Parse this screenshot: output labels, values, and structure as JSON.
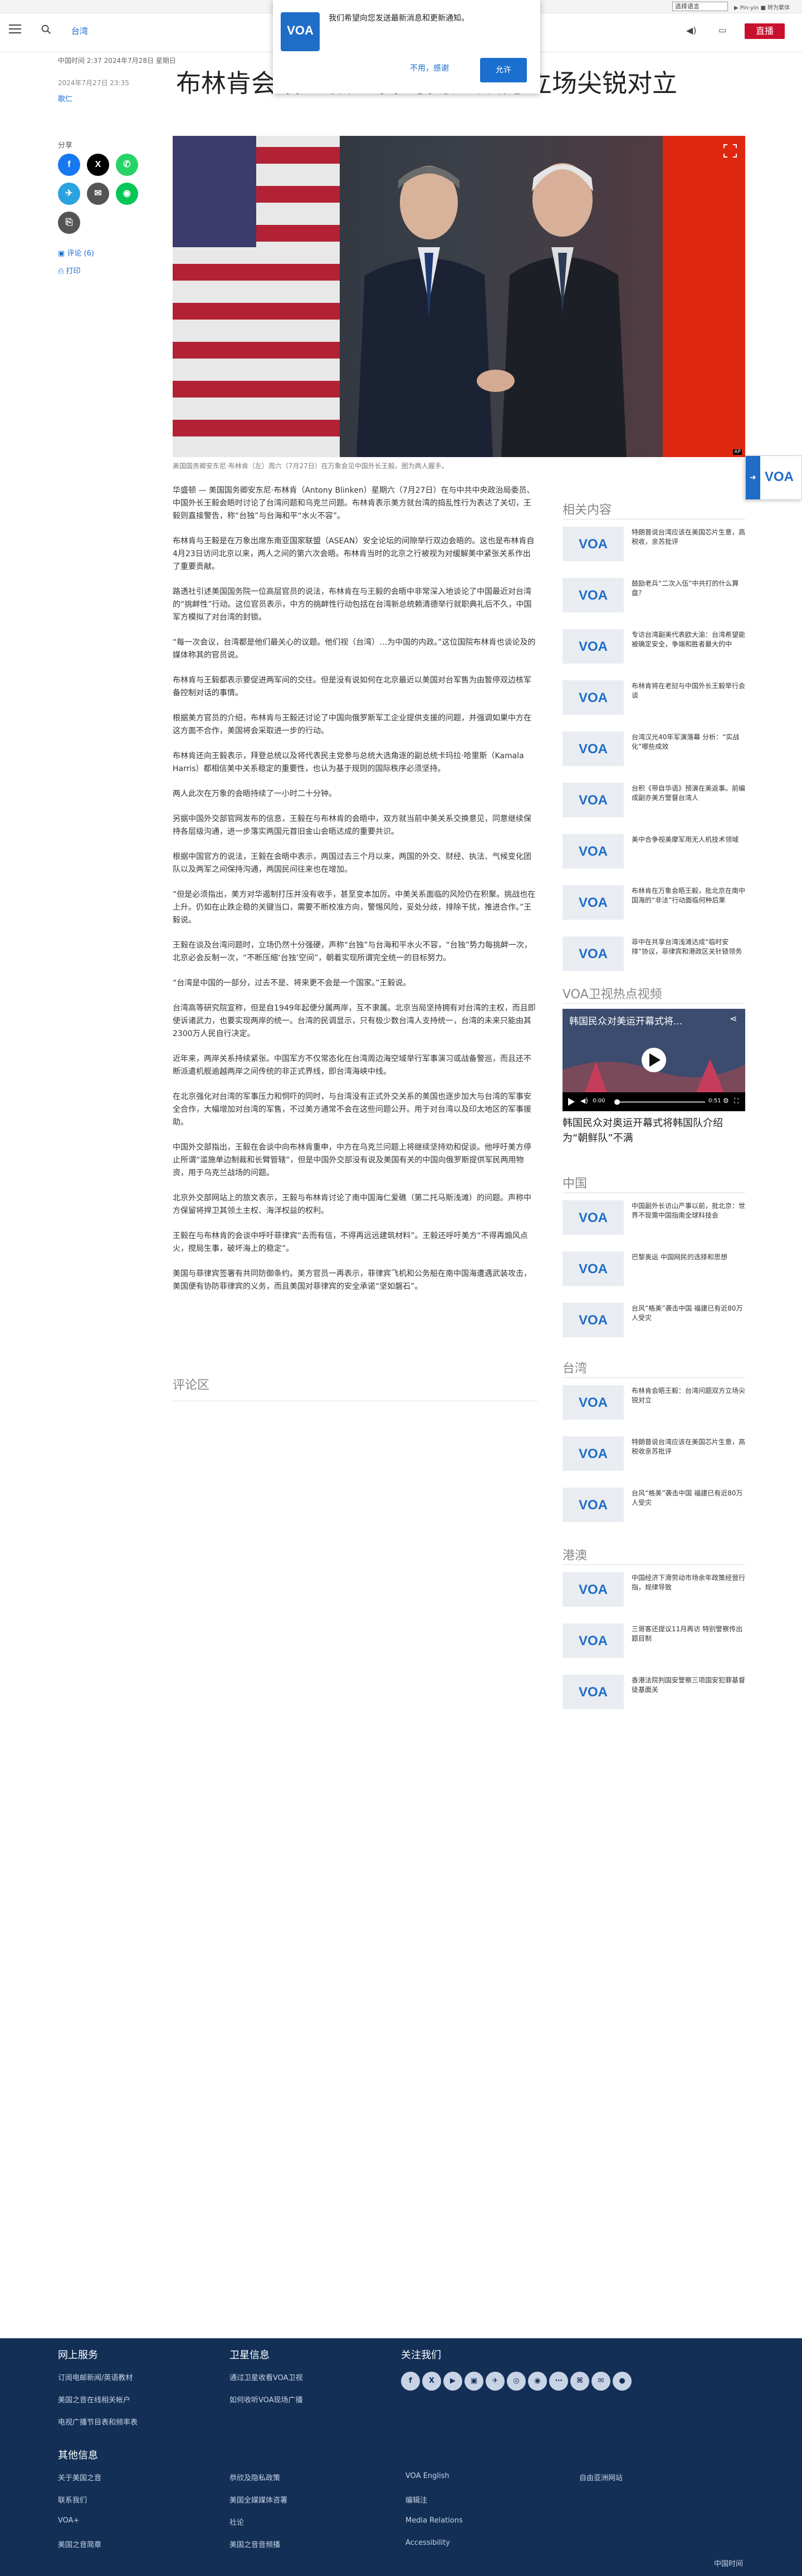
{
  "top_bar": {
    "language_select": "选择语言",
    "links": "▶ Pin-yin  ■ 转为繁体"
  },
  "header": {
    "section": "台湾",
    "live_label": "直播"
  },
  "notification": {
    "message": "我们希望向您发送最新消息和更新通知。",
    "deny": "不用，感谢",
    "allow": "允许"
  },
  "article": {
    "dateline": "中国时间 2:37 2024年7月28日 星期日",
    "published": "2024年7月27日 23:35",
    "author": "歌仁",
    "title": "布林肯会晤王毅：台湾问题双方立场尖锐对立",
    "share_label": "分享",
    "comments_link": "评论 (6)",
    "print_link": "打印",
    "caption": "美国国务卿安东尼·布林肯（左）周六（7月27日）在万象会见中国外长王毅。图为两人握手。",
    "paragraphs": [
      "华盛顿 — 美国国务卿安东尼·布林肯（Antony Blinken）星期六（7月27日）在与中共中央政治局委员、中国外长王毅会晤时讨论了台湾问题和乌克兰问题。布林肯表示美方就台湾的捣乱性行为表达了关切，王毅则直接警告，称“台独”与台海和平“水火不容”。",
      "布林肯与王毅是在万象出席东南亚国家联盟（ASEAN）安全论坛的间隙举行双边会晤的。这也是布林肯自4月23日访问北京以来，两人之间的第六次会晤。布林肯当时的北京之行被视为对缓解美中紧张关系作出了重要贡献。",
      "路透社引述美国国务院一位高层官员的说法，布林肯在与王毅的会晤中非常深入地谈论了中国最近对台湾的“挑衅性”行动。这位官员表示，中方的挑衅性行动包括在台湾新总统赖清德举行就职典礼后不久，中国军方模拟了对台湾的封锁。",
      "“每一次会议，台湾都是他们最关心的议题。他们视（台湾）…为中国的内政。”这位国院布林肯也谈论及的媒体称其的官员说。",
      "布林肯与王毅都表示要促进两军间的交往。但是没有说如何在北京最近以美国对台军售为由暂停双边核军备控制对话的事情。",
      "根据美方官员的介绍，布林肯与王毅还讨论了中国向俄罗斯军工企业提供支援的问题，并强调如果中方在这方面不合作，美国将会采取进一步的行动。",
      "布林肯还向王毅表示，拜登总统以及将代表民主党参与总统大选角逐的副总统卡玛拉·哈里斯（Kamala Harris）都相信美中关系稳定的重要性，也认为基于规则的国际秩序必须坚持。",
      "两人此次在万象的会晤持续了一小时二十分钟。",
      "另据中国外交部官网发布的信息，王毅在与布林肯的会晤中，双方就当前中美关系交换意见，同意继续保持各层级沟通，进一步落实两国元首旧金山会晤达成的重要共识。",
      "根据中国官方的说法，王毅在会晤中表示，两国过去三个月以来，两国的外交、财经、执法、气候变化团队以及两军之间保持沟通，两国民间往来也在增加。",
      "“但是必须指出，美方对华遏制打压并没有收手，甚至变本加厉。中美关系面临的风险仍在积聚。挑战也在上升。仍如在止跌企稳的关键当口，需要不断校准方向，警惕风险，妥处分歧，排除干扰，推进合作。”王毅说。",
      "王毅在谈及台湾问题时，立场仍然十分强硬，声称“台独”与台海和平水火不容，“台独”势力每挑衅一次，北京必会反制一次，“不断压缩‘台独’空间”，朝着实现所谓完全统一的目标努力。",
      "“台湾是中国的一部分，过去不是、将来更不会是一个国家。”王毅说。",
      "台湾高等研究院宣称，但是自1949年起便分属两岸，互不隶属。北京当局坚持拥有对台湾的主权，而且即使诉诸武力，也要实现两岸的统一。台湾的民调显示，只有极少数台湾人支持统一，台湾的未来只能由其2300万人民自行决定。",
      "近年来，两岸关系持续紧张。中国军方不仅常态化在台湾周边海空域举行军事演习或战备警巡，而且还不断派遣机舰逾越两岸之间传统的非正式界线，即台湾海峡中线。",
      "在北京强化对台湾的军事压力和恫吓的同时，与台湾没有正式外交关系的美国也逐步加大与台湾的军事安全合作，大幅增加对台湾的军售，不过美方通常不会在这些问题公开。用于对台湾以及印太地区的军事援助。",
      "中国外交部指出，王毅在会谈中向布林肯重申，中方在乌克兰问题上将继续坚持劝和促谈。他呼吁美方停止所谓“滥施单边制裁和长臂管辖”，但是中国外交部没有说及美国有关的中国向俄罗斯提供军民两用物资，用于乌克兰战场的问题。",
      "北京外交部网站上的旅文表示，王毅与布林肯讨论了南中国海仁爱礁（第二托马斯浅滩）的问题。声称中方保留将捍卫其领土主权、海洋权益的权利。",
      "王毅在与布林肯的会谈中呼吁菲律宾“去而有信，不得再远远建筑材料”。王毅还呼吁美方“不得再煽风点火，搅局生事，破坏海上的稳定”。",
      "美国与菲律宾签署有共同防御条约。美方官员一再表示，菲律宾飞机和公务船在南中国海遭遇武装攻击，美国便有协防菲律宾的义务，而且美国对菲律宾的安全承诺“坚如磐石”。"
    ],
    "comments_header": "评论区"
  },
  "sidebar": {
    "related_title": "相关内容",
    "related": [
      "特朗普说台湾应该在美国芯片生意，高税收，亲苏批评",
      "鼓励老兵“二次入伍”中共打的什么算盘？",
      "专访台湾副美代表欧大渝：台湾希望能被确定安全，争端和胜者最大的中",
      "布林肯将在老挝与中国外长王毅举行会谈",
      "台湾汉光40年军演落幕 分析：“实战化”哪些成效",
      "台积《带自华语》预演在美返事。前编成副亦美方警督台湾人",
      "美中合争视美摩军用无人机技术领域",
      "布林肯在万象会晤王毅，批北京在南中国海的“非法”行动面临何种后果",
      "菲中在共享台湾浅滩达成“临时安排”协议，菲律宾和港政区关针锁领务"
    ],
    "video_title_header": "VOA卫视热点视频",
    "video_overlay": "韩国民众对美运开幕式将...",
    "video_time": "0:00",
    "video_duration": "0:51",
    "video_caption": "韩国民众对奥运开幕式将韩国队介绍为“朝鲜队”不满",
    "china_title": "中国",
    "china": [
      "中国副外长访山产事以前，批北京：世界不现需中国指南全球科技会",
      "巴黎奥运 中国网民的选择和思想",
      "台风“格美”袭击中国 福建已有近80万人受灾"
    ],
    "taiwan_title": "台湾",
    "taiwan": [
      "布林肯会晤王毅：台湾问题双方立场尖锐对立",
      "特朗普说台湾应该在美国芯片生意，高税收亲苏批评",
      "台风“格美”袭击中国 福建已有近80万人受灾"
    ],
    "hk_title": "港澳",
    "hk": [
      "中国经济下滑劳动市场余年政策经营行指，规律导致",
      "三哥客还提议11月再访 特别警察传出题目制",
      "香港法院判国安警察三项国安犯罪基督徒基面关"
    ]
  },
  "footer": {
    "col1_title": "网上服务",
    "col1": [
      "订阅电邮新闻/英语教材",
      "美国之音在线相关帐户",
      "电视广播节目表和频率表"
    ],
    "col2_title": "卫星信息",
    "col2": [
      "通过卫星收看VOA卫视",
      "如何收听VOA现场广播"
    ],
    "col3_title": "关注我们",
    "social": [
      "f",
      "X",
      "▶",
      "▣",
      "✈",
      "◎",
      "◉",
      "⋯",
      "⌘",
      "✉",
      "●"
    ],
    "more_title": "其他信息",
    "more": [
      [
        "关于美国之音",
        "恭欣及隐私政策",
        "VOA English",
        "自由亚洲网站"
      ],
      [
        "联系我们",
        "美国全媒媒体咨署",
        "编辑注",
        ""
      ],
      [
        "VOA+",
        "社论",
        "Media Relations",
        ""
      ],
      [
        "美国之音简章",
        "美国之音音频播",
        "Accessibility",
        ""
      ]
    ],
    "bottom_right": "中国时间"
  }
}
